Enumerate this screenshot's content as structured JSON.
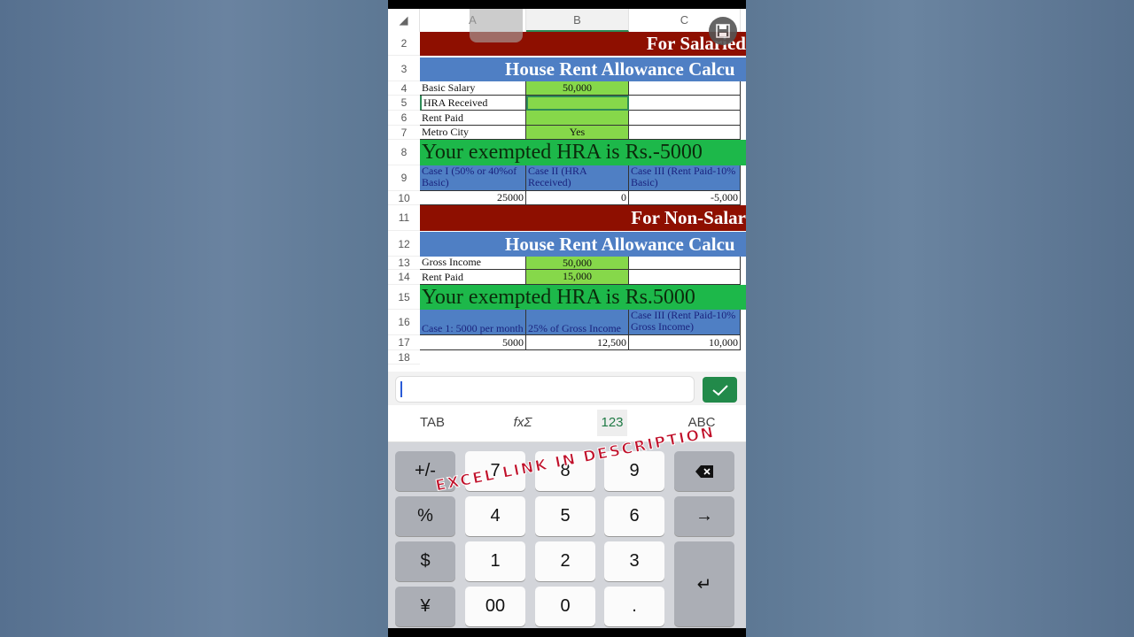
{
  "columns": [
    "A",
    "B",
    "C"
  ],
  "rows": [
    "2",
    "3",
    "4",
    "5",
    "6",
    "7",
    "8",
    "9",
    "10",
    "11",
    "12",
    "13",
    "14",
    "15",
    "16",
    "17",
    "18"
  ],
  "salaried": {
    "banner": "For Salaried",
    "title": "House Rent Allowance Calcu",
    "labels": [
      "Basic Salary",
      "HRA Received",
      "Rent Paid",
      "Metro City"
    ],
    "values": [
      "50,000",
      "",
      "",
      "Yes"
    ],
    "result": "Your exempted HRA is Rs.-5000",
    "case_headers": [
      "Case I (50% or 40%of Basic)",
      "Case II (HRA Received)",
      "Case III (Rent Paid-10% Basic)"
    ],
    "case_values": [
      "25000",
      "0",
      "-5,000"
    ]
  },
  "non_salaried": {
    "banner": "For Non-Salar",
    "title": "House Rent Allowance Calcu",
    "labels": [
      "Gross Income",
      "Rent Paid"
    ],
    "values": [
      "50,000",
      "15,000"
    ],
    "result": "Your exempted HRA is Rs.5000",
    "case_headers": [
      "Case 1: 5000 per month",
      "25% of Gross Income",
      "Case III (Rent Paid-10% Gross Income)"
    ],
    "case_values": [
      "5000",
      "12,500",
      "10,000"
    ]
  },
  "formula_bar": {
    "value": ""
  },
  "keyboard_tabs": [
    "TAB",
    "fxΣ",
    "123",
    "ABC"
  ],
  "active_tab": "123",
  "keys": [
    "+/-",
    "7",
    "8",
    "9",
    "%",
    "4",
    "5",
    "6",
    "$",
    "1",
    "2",
    "3",
    "¥",
    "00",
    "0",
    "."
  ],
  "watermark": "EXCEL LINK IN DESCRIPTION",
  "colors": {
    "red_banner": "#8e0f00",
    "blue_header": "#4f7fc4",
    "green_result": "#1db84a",
    "input_green": "#86d84a",
    "accent": "#228a4a"
  }
}
